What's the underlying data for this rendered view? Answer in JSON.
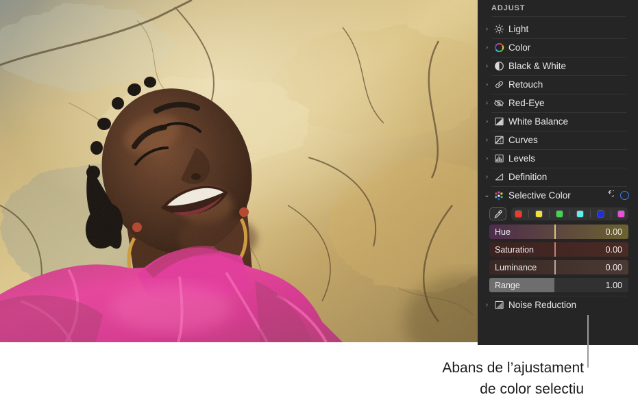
{
  "photo": {
    "alt_description": "Woman with braided hair in a pink sheer blouse lying against a sunlit golden rock face"
  },
  "panel": {
    "section_title": "ADJUST",
    "rows": [
      {
        "label": "Light",
        "icon": "sun-icon",
        "expanded": false
      },
      {
        "label": "Color",
        "icon": "color-wheel-icon",
        "expanded": false
      },
      {
        "label": "Black & White",
        "icon": "half-circle-icon",
        "expanded": false
      },
      {
        "label": "Retouch",
        "icon": "bandage-icon",
        "expanded": false
      },
      {
        "label": "Red-Eye",
        "icon": "eye-slash-icon",
        "expanded": false
      },
      {
        "label": "White Balance",
        "icon": "white-balance-icon",
        "expanded": false
      },
      {
        "label": "Curves",
        "icon": "curves-icon",
        "expanded": false
      },
      {
        "label": "Levels",
        "icon": "levels-icon",
        "expanded": false
      },
      {
        "label": "Definition",
        "icon": "definition-icon",
        "expanded": false
      }
    ],
    "selective_color": {
      "label": "Selective Color",
      "icon": "selective-color-dots-icon",
      "expanded": true,
      "reset_icon": "reset-arrow-icon",
      "toggle_icon": "enable-circle-icon",
      "toggle_color": "#2f81f7",
      "eyedropper_icon": "eyedropper-icon",
      "swatches": [
        {
          "name": "swatch-red",
          "color": "#ee3b27"
        },
        {
          "name": "swatch-yellow",
          "color": "#f2e03a"
        },
        {
          "name": "swatch-green",
          "color": "#3ed94a"
        },
        {
          "name": "swatch-cyan",
          "color": "#5ff0e8"
        },
        {
          "name": "swatch-blue",
          "color": "#1f2fe0"
        },
        {
          "name": "swatch-magenta",
          "color": "#ef4ce0"
        }
      ],
      "sliders": [
        {
          "label": "Hue",
          "value": "0.00",
          "knob_pct": 47,
          "track_from": "#4d2d4e",
          "track_to": "#6c6230",
          "knob_color": "#cdc77e"
        },
        {
          "label": "Saturation",
          "value": "0.00",
          "knob_pct": 47,
          "track_from": "#3c2220",
          "track_to": "#4a2b25",
          "knob_color": "#c08478"
        },
        {
          "label": "Luminance",
          "value": "0.00",
          "knob_pct": 47,
          "track_from": "#3a2824",
          "track_to": "#4b3a34",
          "knob_color": "#b9a79f"
        },
        {
          "label": "Range",
          "value": "1.00",
          "knob_pct": 47,
          "track_from": "#313131",
          "track_to": "#313131",
          "fill_color": "#6e6e6e",
          "style": "fill"
        }
      ]
    },
    "noise_reduction": {
      "label": "Noise Reduction",
      "icon": "noise-reduction-icon",
      "expanded": false
    }
  },
  "callout": {
    "line1": "Abans de l’ajustament",
    "line2": "de color selectiu",
    "leader_color": "#9a9a9a"
  }
}
